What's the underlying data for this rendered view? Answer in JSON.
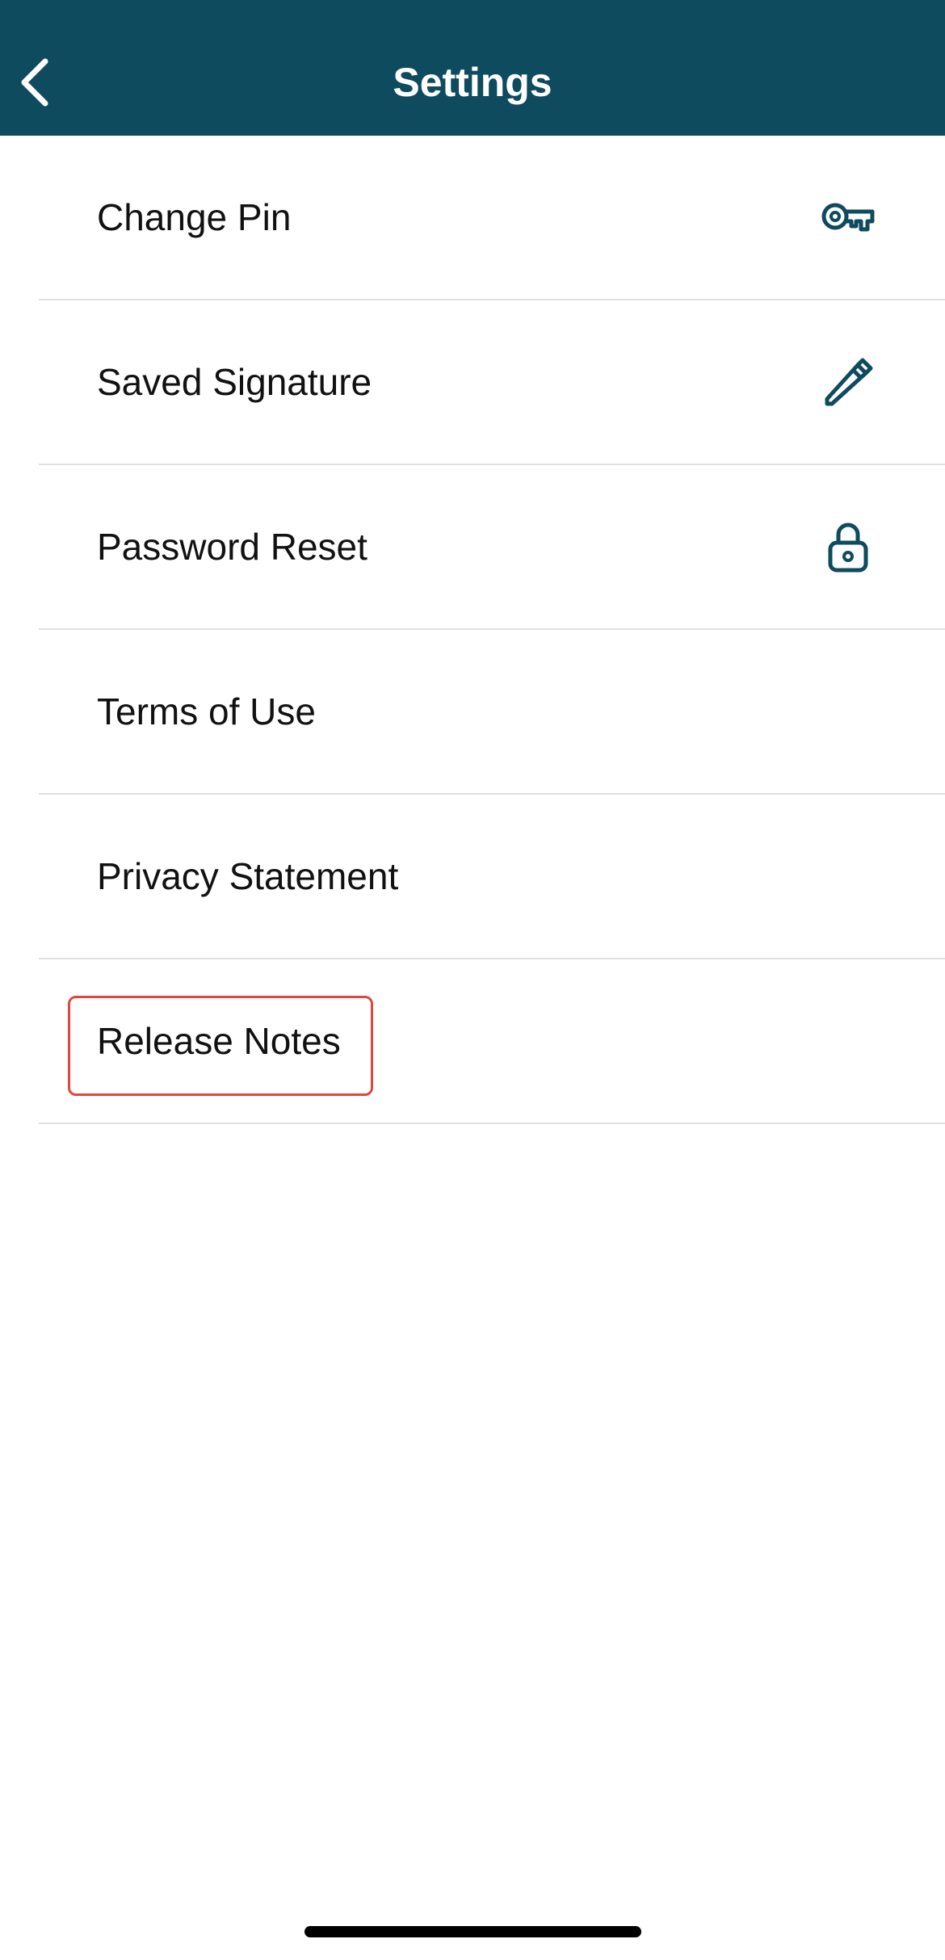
{
  "header": {
    "title": "Settings",
    "back_icon": "chevron-left-icon",
    "background": "#0e4b5e"
  },
  "settings": {
    "items": [
      {
        "label": "Change Pin",
        "icon": "key-icon"
      },
      {
        "label": "Saved Signature",
        "icon": "pencil-icon"
      },
      {
        "label": "Password Reset",
        "icon": "lock-icon"
      },
      {
        "label": "Terms of Use",
        "icon": ""
      },
      {
        "label": "Privacy Statement",
        "icon": ""
      },
      {
        "label": "Release Notes",
        "icon": ""
      }
    ],
    "highlighted_item": "Release Notes"
  },
  "colors": {
    "accent": "#0e4b5e",
    "highlight_border": "#e0463c",
    "divider": "#e0e0e0"
  }
}
